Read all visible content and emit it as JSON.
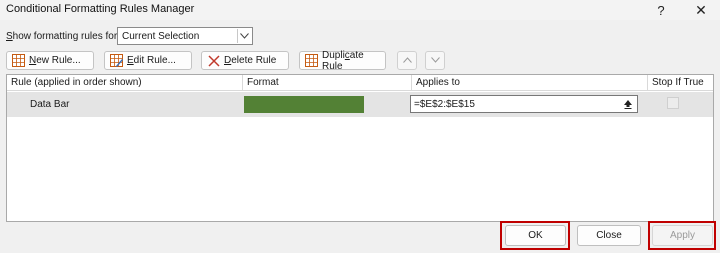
{
  "window": {
    "title": "Conditional Formatting Rules Manager",
    "help_glyph": "?",
    "close_glyph": "✕"
  },
  "show_rules": {
    "label_pre": "",
    "label_key": "S",
    "label_post": "how formatting rules for:",
    "selected": "Current Selection"
  },
  "toolbar": {
    "new_key": "N",
    "new_rest": "ew Rule...",
    "edit_key": "E",
    "edit_rest": "dit Rule...",
    "delete_key": "D",
    "delete_rest": "elete Rule",
    "dup_pre": "Dupli",
    "dup_key": "c",
    "dup_post": "ate Rule"
  },
  "table": {
    "columns": [
      "Rule (applied in order shown)",
      "Format",
      "Applies to",
      "Stop If True"
    ],
    "rows": [
      {
        "rule": "Data Bar",
        "format_color": "#538135",
        "applies_to": "=$E$2:$E$15",
        "stop_if_true": false
      }
    ]
  },
  "footer": {
    "ok": "OK",
    "close": "Close",
    "apply": "Apply"
  },
  "colors": {
    "highlight": "#c00000",
    "data_bar": "#538135"
  }
}
